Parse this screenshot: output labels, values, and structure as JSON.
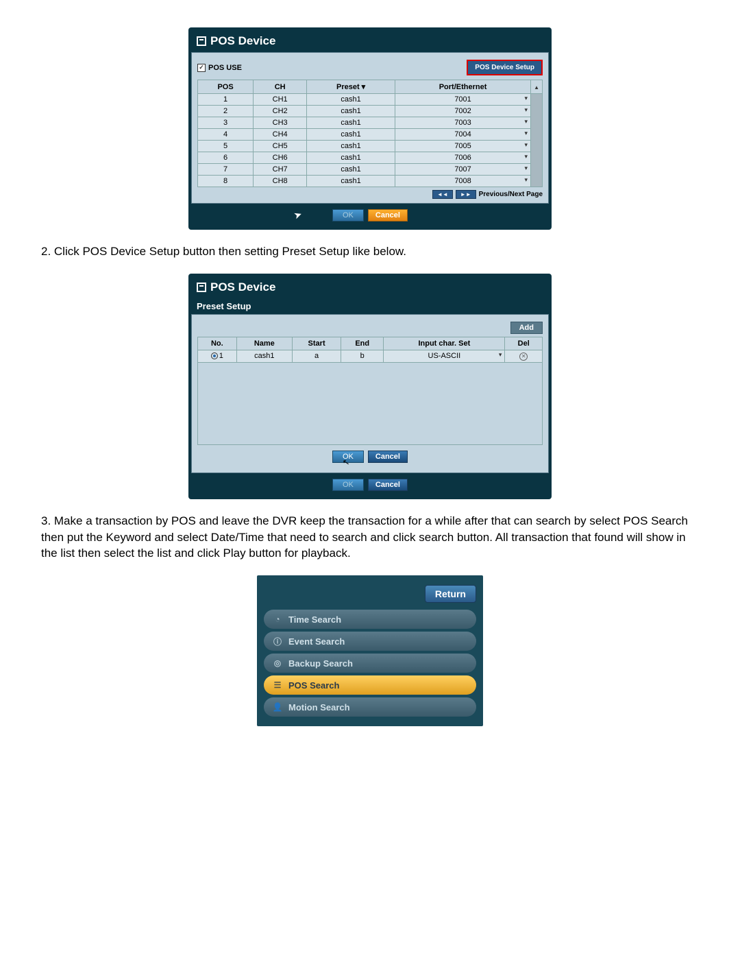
{
  "window1": {
    "title": "POS Device",
    "posUseLabel": "POS USE",
    "setupBtn": "POS Device Setup",
    "headers": {
      "pos": "POS",
      "ch": "CH",
      "preset": "Preset",
      "port": "Port/Ethernet"
    },
    "rows": [
      {
        "pos": "1",
        "ch": "CH1",
        "preset": "cash1",
        "port": "7001"
      },
      {
        "pos": "2",
        "ch": "CH2",
        "preset": "cash1",
        "port": "7002"
      },
      {
        "pos": "3",
        "ch": "CH3",
        "preset": "cash1",
        "port": "7003"
      },
      {
        "pos": "4",
        "ch": "CH4",
        "preset": "cash1",
        "port": "7004"
      },
      {
        "pos": "5",
        "ch": "CH5",
        "preset": "cash1",
        "port": "7005"
      },
      {
        "pos": "6",
        "ch": "CH6",
        "preset": "cash1",
        "port": "7006"
      },
      {
        "pos": "7",
        "ch": "CH7",
        "preset": "cash1",
        "port": "7007"
      },
      {
        "pos": "8",
        "ch": "CH8",
        "preset": "cash1",
        "port": "7008"
      }
    ],
    "pagerLabel": "Previous/Next Page",
    "okLabel": "OK",
    "cancelLabel": "Cancel"
  },
  "step2Text": "2. Click POS Device Setup button then setting Preset Setup like below.",
  "window2": {
    "title": "POS Device",
    "subheader": "Preset Setup",
    "addLabel": "Add",
    "headers": {
      "no": "No.",
      "name": "Name",
      "start": "Start",
      "end": "End",
      "charset": "Input char. Set",
      "del": "Del"
    },
    "row": {
      "no": "1",
      "name": "cash1",
      "start": "a",
      "end": "b",
      "charset": "US-ASCII"
    },
    "okLabel": "OK",
    "cancelLabel": "Cancel"
  },
  "step3Text": "3. Make a transaction by POS and leave the DVR keep the transaction for a while after that can search by select POS Search then put the Keyword and select Date/Time that need to search and click search button. All transaction that found will show in the list then select the list and click Play button for playback.",
  "searchMenu": {
    "returnLabel": "Return",
    "items": [
      {
        "label": "Time Search",
        "icon": "clock"
      },
      {
        "label": "Event Search",
        "icon": "info"
      },
      {
        "label": "Backup Search",
        "icon": "disk"
      },
      {
        "label": "POS Search",
        "icon": "list",
        "active": true
      },
      {
        "label": "Motion Search",
        "icon": "person"
      }
    ]
  }
}
